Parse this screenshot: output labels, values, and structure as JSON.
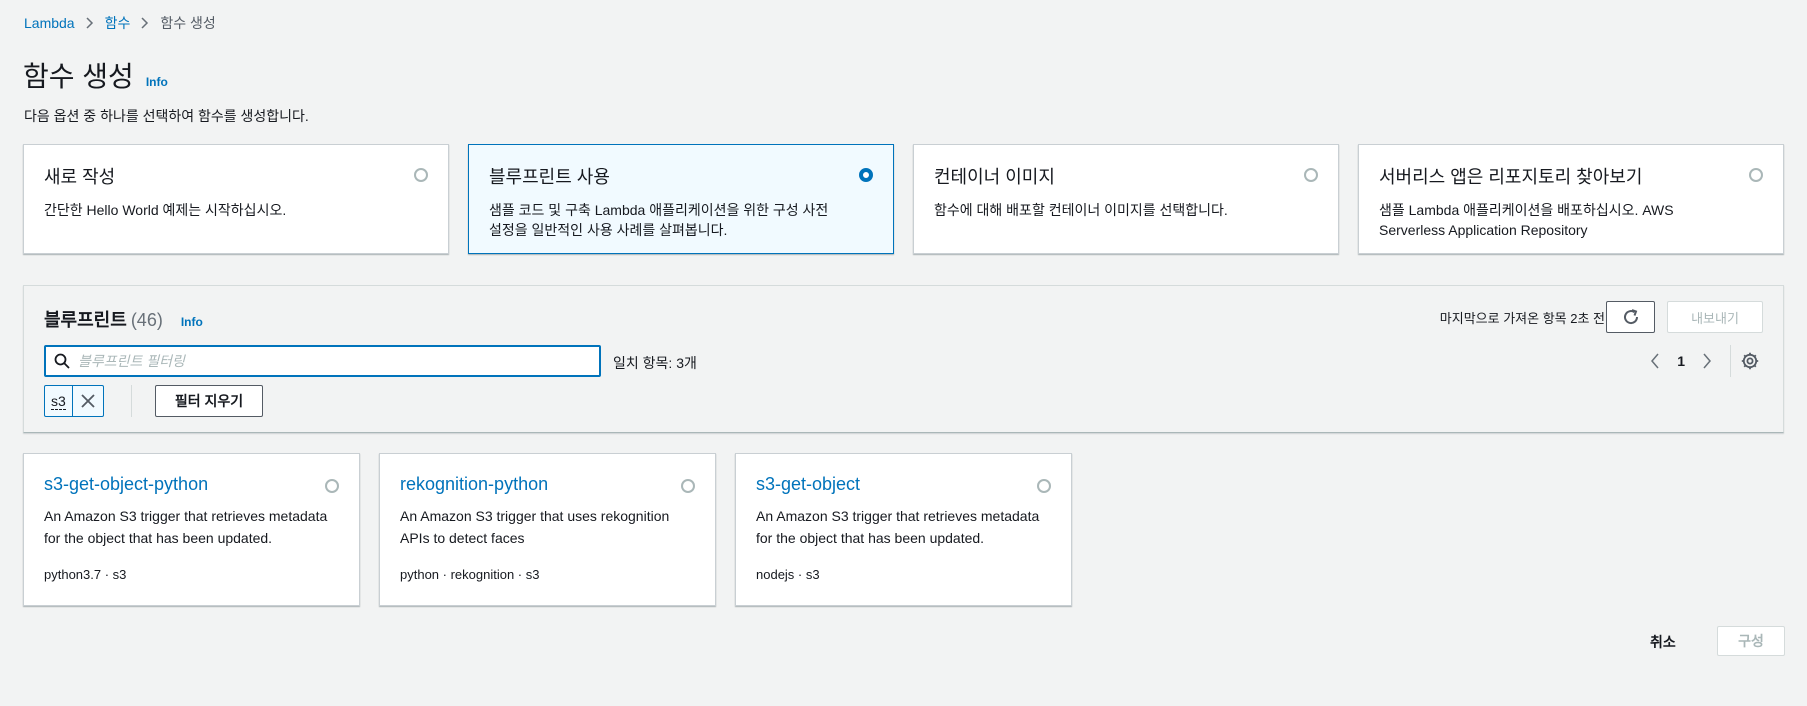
{
  "breadcrumb": {
    "items": [
      "Lambda",
      "함수"
    ],
    "current": "함수 생성"
  },
  "header": {
    "title": "함수 생성",
    "info": "Info",
    "description": "다음 옵션 중 하나를 선택하여 함수를 생성합니다."
  },
  "options": [
    {
      "title": "새로 작성",
      "description": "간단한 Hello World 예제는 시작하십시오.",
      "selected": false
    },
    {
      "title": "블루프린트 사용",
      "description": "샘플 코드 및 구축 Lambda 애플리케이션을 위한 구성 사전 설정을 일반적인 사용 사례를 살펴봅니다.",
      "selected": true
    },
    {
      "title": "컨테이너 이미지",
      "description": "함수에 대해 배포할 컨테이너 이미지를 선택합니다.",
      "selected": false
    },
    {
      "title": "서버리스 앱은 리포지토리 찾아보기",
      "description": "샘플 Lambda 애플리케이션을 배포하십시오. AWS Serverless Application Repository",
      "selected": false
    }
  ],
  "blueprints": {
    "title": "블루프린트",
    "count": "(46)",
    "info": "Info",
    "last_fetched": "마지막으로 가져온 항목 2초 전",
    "export_label": "내보내기",
    "search_placeholder": "블루프린트 필터링",
    "match_count": "일치 항목: 3개",
    "page": "1",
    "token": "s3",
    "clear_label": "필터 지우기",
    "items": [
      {
        "name": "s3-get-object-python",
        "description": "An Amazon S3 trigger that retrieves metadata for the object that has been updated.",
        "tags": "python3.7 · s3"
      },
      {
        "name": "rekognition-python",
        "description": "An Amazon S3 trigger that uses rekognition APIs to detect faces",
        "tags": "python · rekognition · s3"
      },
      {
        "name": "s3-get-object",
        "description": "An Amazon S3 trigger that retrieves metadata for the object that has been updated.",
        "tags": "nodejs · s3"
      }
    ]
  },
  "footer": {
    "cancel_label": "취소",
    "configure_label": "구성"
  },
  "colors": {
    "accent": "#0073bb",
    "background": "#f2f3f3",
    "selected_bg": "#f1faff",
    "disabled": "#aab7b8"
  }
}
